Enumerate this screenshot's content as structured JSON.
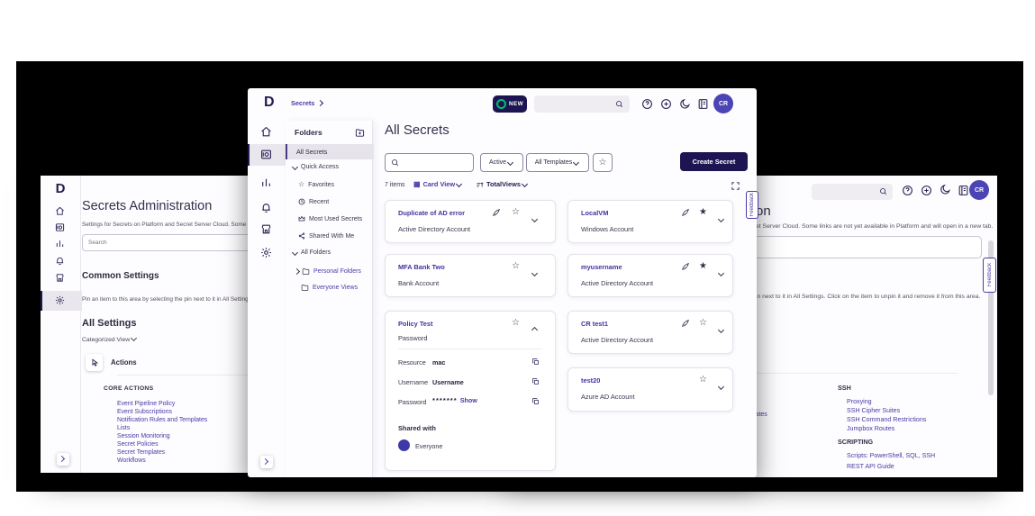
{
  "colors": {
    "brand_navy": "#1D1452",
    "accent_purple": "#4A3BA5",
    "logo_green": "#00BF6F",
    "avatar_bg": "#4B44B5"
  },
  "center": {
    "logo": "D",
    "breadcrumb": "Secrets",
    "new_button": "NEW",
    "avatar": "CR",
    "feedback_tab": "Feedback",
    "folders": {
      "title": "Folders",
      "items": [
        {
          "label": "All Secrets"
        },
        {
          "label": "Quick Access"
        },
        {
          "label": "Favorites"
        },
        {
          "label": "Recent"
        },
        {
          "label": "Most Used Secrets"
        },
        {
          "label": "Shared With Me"
        },
        {
          "label": "All Folders"
        },
        {
          "label": "Personal Folders"
        },
        {
          "label": "Everyone Views"
        }
      ]
    },
    "main": {
      "title": "All Secrets",
      "status_filter": "Active",
      "template_filter": "All Templates",
      "create_button": "Create Secret",
      "items_count": "7 items",
      "view_mode": "Card View",
      "sort_by": "TotalViews",
      "cards": [
        {
          "title": "Duplicate of AD error",
          "subtitle": "Active Directory Account"
        },
        {
          "title": "LocalVM",
          "subtitle": "Windows Account"
        },
        {
          "title": "MFA Bank Two",
          "subtitle": "Bank Account"
        },
        {
          "title": "myusername",
          "subtitle": "Active Directory Account"
        },
        {
          "title": "Policy Test",
          "subtitle": "Password",
          "fields": [
            {
              "label": "Resource",
              "value": "mac"
            },
            {
              "label": "Username",
              "value": "Username"
            },
            {
              "label": "Password",
              "value": "*******",
              "action": "Show"
            }
          ],
          "shared_with_label": "Shared with",
          "shared_with": "Everyone"
        },
        {
          "title": "CR test1",
          "subtitle": "Active Directory Account"
        },
        {
          "title": "test20",
          "subtitle": "Azure AD Account"
        }
      ]
    }
  },
  "left_window": {
    "logo": "D",
    "title": "Secrets Administration",
    "subtitle": "Settings for Secrets on Platform and Secret Server Cloud. Some li",
    "search_placeholder": "Search",
    "common_settings_title": "Common Settings",
    "common_settings_hint": "Pin an item to this area by selecting the pin next to it in All Setting",
    "all_settings_title": "All Settings",
    "view_selector": "Categorized View",
    "category_label": "Actions",
    "group_title": "CORE ACTIONS",
    "links": [
      "Event Pipeline Policy",
      "Event Subscriptions",
      "Notification Rules and Templates",
      "Lists",
      "Session Monitoring",
      "Secret Policies",
      "Secret Templates",
      "Workflows"
    ]
  },
  "right_window": {
    "title_fragment": "on",
    "subtitle_fragment": "et Server Cloud. Some links are not yet available in Platform and will open in a new tab.",
    "hint_fragment": "in next to it in All Settings. Click on the item to unpin it and remove it from this area.",
    "link_fragment": "lates",
    "avatar": "CR",
    "feedback_tab": "Feedback",
    "ssh_title": "SSH",
    "ssh_links": [
      "Proxying",
      "SSH Cipher Suites",
      "SSH Command Restrictions",
      "Jumpbox Routes"
    ],
    "scripting_title": "SCRIPTING",
    "scripting_links": [
      "Scripts: PowerShell, SQL, SSH",
      "REST API Guide"
    ]
  }
}
